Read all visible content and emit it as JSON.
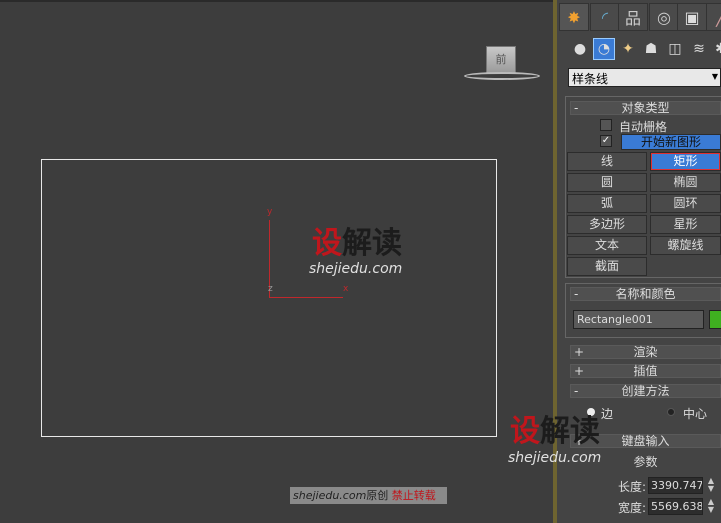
{
  "viewport": {
    "viewcube_label": "前",
    "axes": {
      "y": "y",
      "x": "x",
      "z": "z"
    },
    "watermark": {
      "logo_red": "设",
      "logo_dark": "解读",
      "url": "shejiedu.com"
    },
    "footer": {
      "site": "shejiedu.com",
      "original": "原创",
      "warning": "禁止转载"
    }
  },
  "panel": {
    "tabs": [
      "create",
      "modify",
      "hierarchy",
      "motion",
      "display",
      "utilities"
    ],
    "categories": [
      "geometry",
      "shapes",
      "lights",
      "cameras",
      "helpers",
      "space-warps",
      "systems"
    ],
    "dropdown": "样条线",
    "object_type": {
      "title": "对象类型",
      "sign": "-",
      "autogrid": "自动栅格",
      "autogrid_checked": false,
      "start_new_shape": "开始新图形",
      "start_new_shape_checked": true,
      "buttons": [
        "线",
        "矩形",
        "圆",
        "椭圆",
        "弧",
        "圆环",
        "多边形",
        "星形",
        "文本",
        "螺旋线",
        "截面"
      ],
      "selected": "矩形"
    },
    "name_color": {
      "title": "名称和颜色",
      "sign": "-",
      "name": "Rectangle001",
      "color": "#3fb020"
    },
    "rendering": {
      "title": "渲染",
      "sign": "+"
    },
    "interpolation": {
      "title": "插值",
      "sign": "+"
    },
    "creation_method": {
      "title": "创建方法",
      "sign": "-",
      "edge": "边",
      "center": "中心",
      "selected": "边"
    },
    "keyboard": {
      "title": "键盘输入",
      "sign": "+"
    },
    "parameters": {
      "title": "参数",
      "length_label": "长度:",
      "length": "3390.747",
      "width_label": "宽度:",
      "width": "5569.638"
    },
    "watermark": {
      "logo_red": "设",
      "logo_dark": "解读",
      "url": "shejiedu.com"
    }
  }
}
